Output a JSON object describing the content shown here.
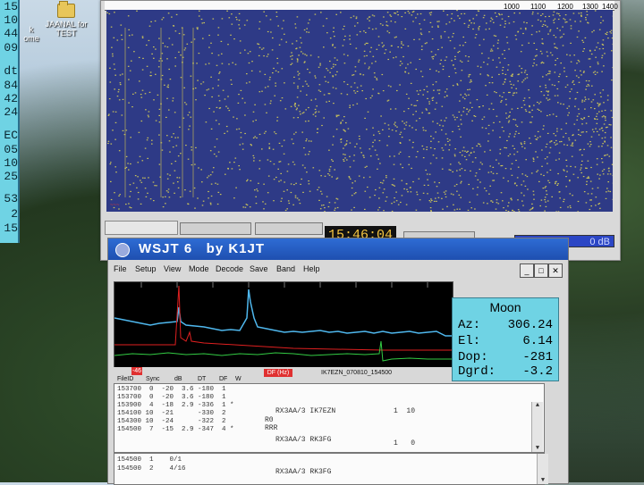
{
  "left_window": {
    "values": [
      "15",
      "10",
      "44",
      "09",
      "dt",
      "84",
      "42",
      "24",
      "EC",
      "05",
      "10",
      "25",
      "53",
      "2",
      "15"
    ]
  },
  "desktop": {
    "icons": [
      {
        "label_lines": [
          "k",
          "ome"
        ]
      },
      {
        "label_lines": [
          "JAANAL for",
          "TEST"
        ]
      }
    ]
  },
  "waterfall": {
    "freq_labels": [
      "1000",
      "1100",
      "1200",
      "1300",
      "1400"
    ],
    "marker": "~~~",
    "clock": "15:46:04",
    "rx_level": "0 dB"
  },
  "wsjt": {
    "title": "WSJT 6   by K1JT",
    "menu": [
      "File",
      "Setup",
      "View",
      "Mode",
      "Decode",
      "Save",
      "Band",
      "Help"
    ],
    "window_buttons": [
      "_",
      "□",
      "✕"
    ],
    "spectrum_neg_label": "-46",
    "df_label": "DF (Hz)",
    "file_label": "IK7EZN_070810_154500",
    "moon": {
      "title": "Moon",
      "rows": [
        {
          "key": "Az:",
          "value": "306.24"
        },
        {
          "key": "El:",
          "value": "6.14"
        },
        {
          "key": "Dop:",
          "value": "-281"
        },
        {
          "key": "Dgrd:",
          "value": "-3.2"
        }
      ]
    },
    "columns": [
      "FileID",
      "Sync",
      "dB",
      "DT",
      "DF",
      "W"
    ],
    "decodes": [
      {
        "text": "153700  0  -20  3.6 -180  1"
      },
      {
        "text": "153700  0  -20  3.6 -180  1"
      },
      {
        "text": "153900  4  -18  2.9 -336  1 *",
        "msg": "RX3AA/3 IK7EZN",
        "extra": "1  10"
      },
      {
        "text": "154100 10  -21      -330  2",
        "msg": "R0"
      },
      {
        "text": "154300 10  -24      -322  2",
        "msg": "RRR"
      },
      {
        "text": "154500  7  -15  2.9 -347  4 *",
        "msg": "RX3AA/3 RK3FG",
        "extra": "1   0"
      }
    ],
    "averages": [
      {
        "text": "154500  1    0/1"
      },
      {
        "text": "154500  2    4/16",
        "msg": "RX3AA/3 RK3FG"
      }
    ]
  }
}
